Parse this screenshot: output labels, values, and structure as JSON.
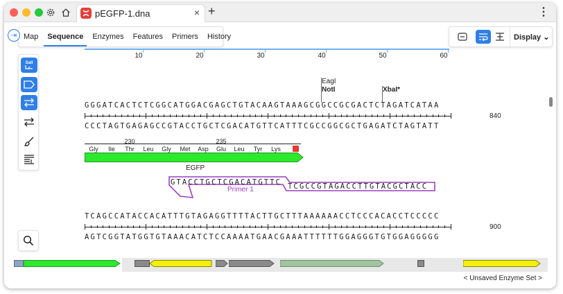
{
  "window": {
    "tab_title": "pEGFP-1.dna",
    "tab_close": "×",
    "new_tab": "+",
    "menu": "⋮"
  },
  "view_tabs": [
    "Map",
    "Sequence",
    "Enzymes",
    "Features",
    "Primers",
    "History"
  ],
  "active_view_tab": "Sequence",
  "toolbar": {
    "display_label": "Display"
  },
  "palette": {
    "sali_label": "SalI"
  },
  "ruler": {
    "ticks": [
      "10",
      "20",
      "30",
      "40",
      "50",
      "60"
    ]
  },
  "enzymes": {
    "eagi": "EagI",
    "noti": "NotI",
    "xbai": "XbaI*"
  },
  "block1": {
    "top_strand": "GGGATCACTCTCGGCATGGACGAGCTGTACAAGTAAAGCGGCCGCGACTCTAGATCATAA",
    "bottom_strand": "CCCTAGTGAGAGCCGTACCTGCTCGACATGTTCATTTCGCCGGCGCTGAGATCTAGTATT",
    "position": "840"
  },
  "translation": {
    "amino_acids": [
      "Gly",
      "Ile",
      "Thr",
      "Leu",
      "Gly",
      "Met",
      "Asp",
      "Glu",
      "Leu",
      "Tyr",
      "Lys"
    ],
    "aa_numbers": [
      "230",
      "235"
    ]
  },
  "feature": {
    "label": "EGFP",
    "color": "#2ee82e"
  },
  "primer": {
    "seq_left": "GTACCTGCTCGACATGTTC",
    "seq_right": "TCGCCGTAGACCTTGTACGCTACC",
    "label": "Primer 1",
    "color": "#9b3fc2"
  },
  "block2": {
    "top_strand": "TCAGCCATACCACATTTGTAGAGGTTTTACTTGCTTTAAAAAACCTCCCACACCTCCCCC",
    "bottom_strand": "AGTCGGTATGGTGTAAACATCTCCAAAATGAACGAAATTTTTTGGAGGGTGTGGAGGGGG",
    "position": "900"
  },
  "footer": {
    "enzyme_set": "< Unsaved Enzyme Set >"
  }
}
